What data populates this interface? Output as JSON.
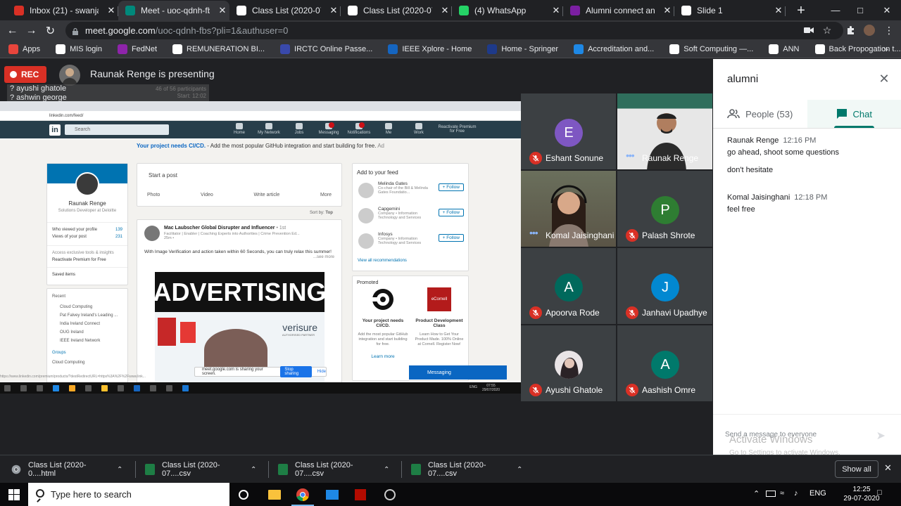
{
  "browser": {
    "tabs": [
      {
        "title": "Inbox (21) - swanjari@",
        "color": "#d93025",
        "active": false
      },
      {
        "title": "Meet - uoc-qdnh-fbs",
        "color": "#00897b",
        "active": true
      },
      {
        "title": "Class List (2020-07-29)",
        "color": "#ffffff",
        "active": false
      },
      {
        "title": "Class List (2020-07-29)",
        "color": "#ffffff",
        "active": false
      },
      {
        "title": "(4) WhatsApp",
        "color": "#25d366",
        "active": false
      },
      {
        "title": "Alumni connect and Al",
        "color": "#7b1fa2",
        "active": false
      },
      {
        "title": "Slide 1",
        "color": "#ffffff",
        "active": false
      }
    ],
    "url_host": "meet.google.com",
    "url_path": "/uoc-qdnh-fbs?pli=1&authuser=0",
    "bookmarks": [
      {
        "label": "Apps",
        "color": "#e8453c"
      },
      {
        "label": "MIS login",
        "color": "#ffffff"
      },
      {
        "label": "FedNet",
        "color": "#8e24aa"
      },
      {
        "label": "REMUNERATION BI...",
        "color": "#ffffff"
      },
      {
        "label": "IRCTC Online Passe...",
        "color": "#3949ab"
      },
      {
        "label": "IEEE Xplore - Home",
        "color": "#1565c0"
      },
      {
        "label": "Home - Springer",
        "color": "#1e3a8a"
      },
      {
        "label": "Accreditation and...",
        "color": "#1e88e5"
      },
      {
        "label": "Soft Computing —...",
        "color": "#ffffff"
      },
      {
        "label": "ANN",
        "color": "#ffffff"
      },
      {
        "label": "Back Propogation t...",
        "color": "#ffffff"
      }
    ]
  },
  "meet": {
    "rec_label": "REC",
    "presenter_text": "Raunak Renge is presenting",
    "attendance": [
      "? ayushi ghatole",
      "? ashwin george"
    ],
    "participants_box": "46 of 56 participants",
    "participants_box2": "Start: 12:02"
  },
  "shared_screen": {
    "url": "linkedin.com/feed/",
    "search": "Search",
    "nav": [
      "Home",
      "My Network",
      "Jobs",
      "Messaging",
      "Notifications",
      "Me",
      "Work",
      "Reactivate Premium for Free"
    ],
    "banner_bold": "Your project needs CI/CD.",
    "banner_rest": " - Add the most popular GitHub integration and start building for free.",
    "banner_ad": "Ad",
    "profile_name": "Raunak Renge",
    "profile_title": "Solutions Developer at Deloitte",
    "profile_views_label": "Who viewed your profile",
    "profile_views": "139",
    "post_views_label": "Views of your post",
    "post_views": "231",
    "premium_1": "Access exclusive tools & insights",
    "premium_2": "Reactivate Premium for Free",
    "saved": "Saved items",
    "recent_title": "Recent",
    "recent": [
      "Cloud Computing",
      "Pat Falvey Ireland's Leading ...",
      "India Ireland Connect",
      "OUG Ireland",
      "IEEE Ireland Network"
    ],
    "groups": "Groups",
    "groups_item": "Cloud Computing",
    "start_post": "Start a post",
    "post_actions": [
      "Photo",
      "Video",
      "Write article",
      "More"
    ],
    "sort_by": "Sort by:",
    "sort_value": "Top",
    "post_author": "Mac Laubscher Global Disrupter and Influencer",
    "post_degree": "• 1st",
    "post_sub": "Facilitator | Enabler | Coaching Experts into Authorities | Crime Prevention Ed...",
    "post_time": "25m •",
    "post_text": "With Image Verification and action taken within 60 Seconds, you can truly relax this summer!",
    "see_more": "...see more",
    "advertising": "ADVERTISING",
    "verisure": "verisure",
    "verisure_sub": "AUTHORISED PARTNER",
    "feed_title": "Add to your feed",
    "feed_items": [
      {
        "name": "Melinda Gates",
        "sub": "Co-chair of the Bill & Melinda Gates Foundatio..."
      },
      {
        "name": "Capgemini",
        "sub": "Company • Information Technology and Services"
      },
      {
        "name": "Infosys",
        "sub": "Company • Information Technology and Services"
      }
    ],
    "follow": "Follow",
    "view_all": "View all recommendations",
    "promoted": "Promoted",
    "promo1_title": "Your project needs CI/CD.",
    "promo1_desc": "Add the most popular GitHub integration and start building for free.",
    "promo1_link": "Learn more",
    "promo2_title": "Product Development Class",
    "promo2_desc": "Learn How to Get Your Product Made. 100% Online at Cornell. Register Now!",
    "ecornell": "eCornell",
    "share_text": "meet.google.com is sharing your screen.",
    "stop_sharing": "Stop sharing",
    "hide": "Hide",
    "messaging": "Messaging",
    "status_url": "https://www.linkedin.com/premium/products/?destRedirectURL=https%3A%2F%2Fwww.link...",
    "clock_time": "07:55",
    "clock_date": "29/07/2020",
    "lang": "ENG"
  },
  "participants": [
    {
      "name": "Eshant Sonune",
      "initial": "E",
      "color": "#7e57c2",
      "video": false,
      "muted": true
    },
    {
      "name": "Raunak Renge",
      "initial": "",
      "color": "#3c4043",
      "video": true,
      "muted": false
    },
    {
      "name": "Komal Jaisinghani",
      "initial": "",
      "color": "#3c4043",
      "video": true,
      "muted": false
    },
    {
      "name": "Palash Shrote",
      "initial": "P",
      "color": "#2e7d32",
      "video": false,
      "muted": true
    },
    {
      "name": "Apoorva Rode",
      "initial": "A",
      "color": "#00695c",
      "video": false,
      "muted": true
    },
    {
      "name": "Janhavi Upadhye",
      "initial": "J",
      "color": "#0288d1",
      "video": false,
      "muted": true
    },
    {
      "name": "Ayushi Ghatole",
      "initial": "",
      "color": "#5d4a5a",
      "video": false,
      "muted": true
    },
    {
      "name": "Aashish Omre",
      "initial": "A",
      "color": "#00796b",
      "video": false,
      "muted": true
    }
  ],
  "panel": {
    "title": "alumni",
    "people_label": "People (53)",
    "chat_label": "Chat",
    "messages": [
      {
        "sender": "Raunak Renge",
        "time": "12:16 PM",
        "lines": [
          "go ahead, shoot some questions",
          "don't hesitate"
        ]
      },
      {
        "sender": "Komal Jaisinghani",
        "time": "12:18 PM",
        "lines": [
          "feel free"
        ]
      }
    ],
    "input_placeholder": "Send a message to everyone",
    "watermark_1": "Activate Windows",
    "watermark_2": "Go to Settings to activate Windows."
  },
  "downloads": {
    "items": [
      {
        "name": "Class List (2020-0....html",
        "color": "#9aa0a6"
      },
      {
        "name": "Class List (2020-07....csv",
        "color": "#1e7e45"
      },
      {
        "name": "Class List (2020-07....csv",
        "color": "#1e7e45"
      },
      {
        "name": "Class List (2020-07....csv",
        "color": "#1e7e45"
      }
    ],
    "show_all": "Show all"
  },
  "taskbar": {
    "search_placeholder": "Type here to search",
    "lang": "ENG",
    "time": "12:25",
    "date": "29-07-2020"
  }
}
